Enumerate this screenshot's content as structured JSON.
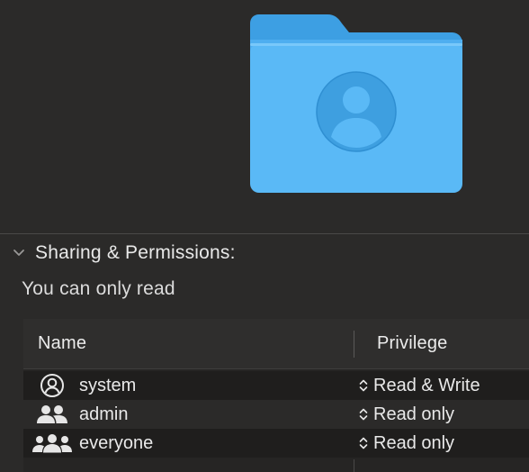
{
  "preview": {
    "icon": "user-home-folder-icon",
    "folder_color": "#5AB9F6"
  },
  "sharing": {
    "title": "Sharing & Permissions:",
    "expanded": true,
    "chevron_icon": "chevron-down-icon",
    "access_note": "You can only read"
  },
  "table": {
    "columns": {
      "name": "Name",
      "privilege": "Privilege"
    },
    "rows": [
      {
        "icon": "single-user-icon",
        "name": "system",
        "privilege": "Read & Write"
      },
      {
        "icon": "two-users-icon",
        "name": "admin",
        "privilege": "Read only"
      },
      {
        "icon": "group-users-icon",
        "name": "everyone",
        "privilege": "Read only"
      }
    ],
    "stepper_icon": "up-down-stepper-icon"
  }
}
